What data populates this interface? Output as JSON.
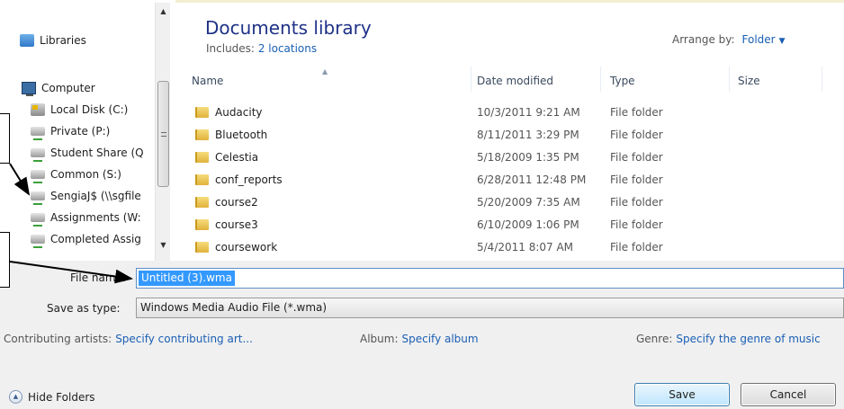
{
  "nav": {
    "libraries": "Libraries",
    "computer": "Computer",
    "drives": [
      {
        "label": "Local Disk (C:)",
        "icon": "local-disk-icon"
      },
      {
        "label": "Private (P:)",
        "icon": "network-drive-icon"
      },
      {
        "label": "Student Share (Q",
        "icon": "network-drive-icon"
      },
      {
        "label": "Common (S:)",
        "icon": "network-drive-icon"
      },
      {
        "label": "SengiaJ$ (\\\\sgfile",
        "icon": "network-drive-icon"
      },
      {
        "label": "Assignments (W:",
        "icon": "network-drive-icon"
      },
      {
        "label": "Completed Assig",
        "icon": "network-drive-icon"
      }
    ]
  },
  "library": {
    "title": "Documents library",
    "includes_label": "Includes:",
    "includes_link": "2 locations",
    "arrange_label": "Arrange by:",
    "arrange_value": "Folder"
  },
  "columns": {
    "name": "Name",
    "date": "Date modified",
    "type": "Type",
    "size": "Size"
  },
  "files": [
    {
      "name": "Audacity",
      "date": "10/3/2011 9:21 AM",
      "type": "File folder"
    },
    {
      "name": "Bluetooth",
      "date": "8/11/2011 3:29 PM",
      "type": "File folder"
    },
    {
      "name": "Celestia",
      "date": "5/18/2009 1:35 PM",
      "type": "File folder"
    },
    {
      "name": "conf_reports",
      "date": "6/28/2011 12:48 PM",
      "type": "File folder"
    },
    {
      "name": "course2",
      "date": "5/20/2009 7:35 AM",
      "type": "File folder"
    },
    {
      "name": "course3",
      "date": "6/10/2009 1:06 PM",
      "type": "File folder"
    },
    {
      "name": "coursework",
      "date": "5/4/2011 8:07 AM",
      "type": "File folder"
    }
  ],
  "form": {
    "file_name_label": "File name:",
    "file_name_value": "Untitled (3).wma",
    "save_type_label": "Save as type:",
    "save_type_value": "Windows Media Audio File (*.wma)"
  },
  "meta": {
    "artists_label": "Contributing artists:",
    "artists_value": "Specify contributing art...",
    "album_label": "Album:",
    "album_value": "Specify album",
    "genre_label": "Genre:",
    "genre_value": "Specify the genre of music"
  },
  "footer": {
    "hide_folders": "Hide Folders",
    "save": "Save",
    "cancel": "Cancel"
  },
  "colors": {
    "title_blue": "#1e3287",
    "link_blue": "#1a5fb4",
    "selection": "#3399ff"
  }
}
